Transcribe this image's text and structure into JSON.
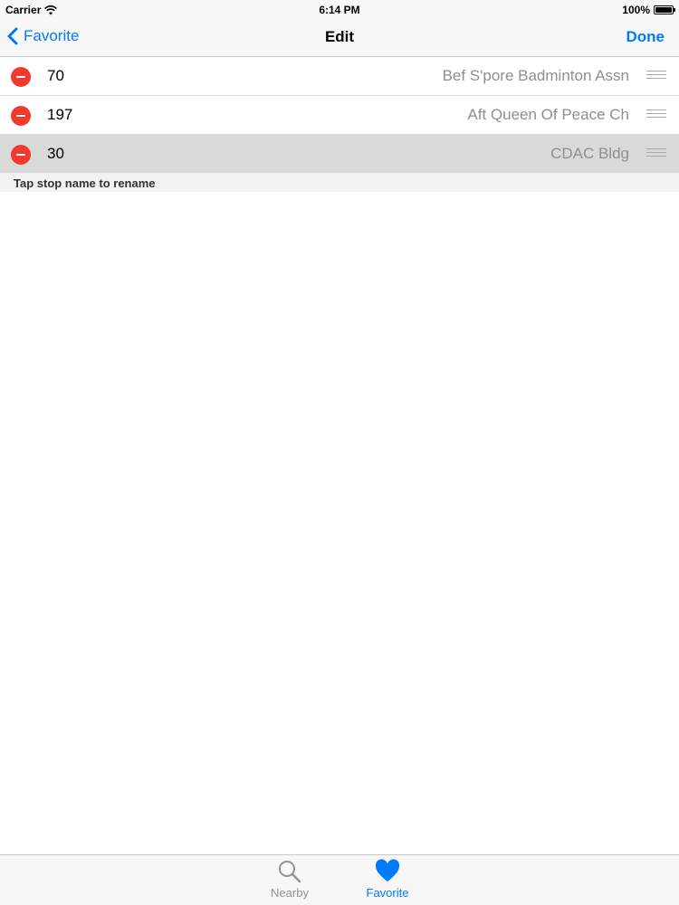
{
  "status_bar": {
    "carrier": "Carrier",
    "time": "6:14 PM",
    "battery": "100%",
    "battery_level": 1.0
  },
  "nav": {
    "back_label": "Favorite",
    "title": "Edit",
    "done_label": "Done"
  },
  "list": {
    "rows": [
      {
        "number": "70",
        "name": "Bef S'pore Badminton Assn",
        "highlighted": false
      },
      {
        "number": "197",
        "name": "Aft Queen Of Peace Ch",
        "highlighted": false
      },
      {
        "number": "30",
        "name": "CDAC Bldg",
        "highlighted": true
      }
    ],
    "footer": "Tap stop name to rename"
  },
  "tab_bar": {
    "tabs": [
      {
        "label": "Nearby",
        "icon": "search-icon",
        "selected": false
      },
      {
        "label": "Favorite",
        "icon": "heart-icon",
        "selected": true
      }
    ]
  },
  "colors": {
    "accent": "#007aff",
    "delete": "#f03a2e",
    "secondary_text": "#8e8e93",
    "highlight_row": "#d9d9d9"
  }
}
